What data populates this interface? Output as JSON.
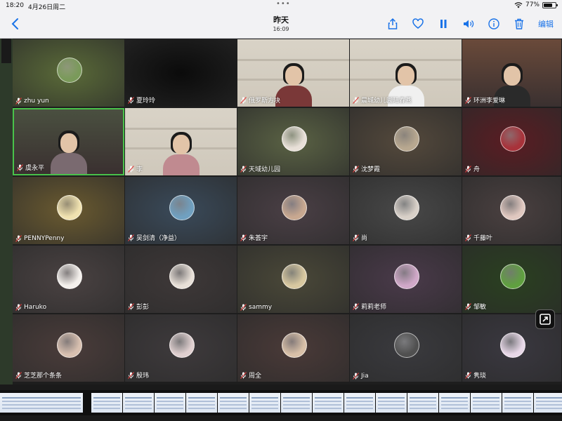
{
  "status_bar": {
    "time": "18:20",
    "date": "4月26日周二",
    "battery_pct": 77,
    "battery_text": "77%"
  },
  "nav": {
    "title": "昨天",
    "subtitle": "16:09",
    "edit_label": "编辑"
  },
  "participants": [
    {
      "name": "zhu yun",
      "bg": "#5a6a38",
      "avatar": "#7a9a5a"
    },
    {
      "name": "夏玲玲",
      "bg": "#0b0b0b"
    },
    {
      "name": "俄罗斯方块",
      "bg": "#cfc8bb",
      "video": true,
      "shirt": "#7a3838"
    },
    {
      "name": "晨城幼儿园陆春燕",
      "bg": "#cfc8bb",
      "video": true,
      "shirt": "#f0f0f0"
    },
    {
      "name": "环洲李爱琳",
      "bg": "#6a4a3a",
      "video": true,
      "shirt": "#2a2a2a"
    },
    {
      "name": "虞永平",
      "bg": "#4a5040",
      "video": true,
      "shirt": "#7a6a70",
      "active": true
    },
    {
      "name": "李",
      "bg": "#cfc8bb",
      "video": true,
      "shirt": "#c08a90"
    },
    {
      "name": "天域幼儿园",
      "bg": "#5a6244",
      "avatar": "#e8e0d8"
    },
    {
      "name": "沈梦霞",
      "bg": "#54493c",
      "avatar": "#b8a890"
    },
    {
      "name": "舟",
      "bg": "#5a1c22",
      "avatar": "#a8323a"
    },
    {
      "name": "PENNYPenny",
      "bg": "#6a5a30",
      "avatar": "#f0e2b0"
    },
    {
      "name": "吴剑清（净益）",
      "bg": "#3a4a5a",
      "avatar": "#70a0c0"
    },
    {
      "name": "朱荟宇",
      "bg": "#4a3f45",
      "avatar": "#c8a890"
    },
    {
      "name": "尚",
      "bg": "#484848",
      "avatar": "#d8d0c8"
    },
    {
      "name": "千藤叶",
      "bg": "#4a4040",
      "avatar": "#e0c8c0"
    },
    {
      "name": "Haruko",
      "bg": "#4a4242",
      "avatar": "#f4f0ec"
    },
    {
      "name": "彭彭",
      "bg": "#3e3838",
      "avatar": "#e8e0d8"
    },
    {
      "name": "sammy",
      "bg": "#4a4838",
      "avatar": "#d8c8a0"
    },
    {
      "name": "莉莉老师",
      "bg": "#4a3a4a",
      "avatar": "#d0a8c8"
    },
    {
      "name": "邹敏",
      "bg": "#2a4020",
      "avatar": "#60a040"
    },
    {
      "name": "芝芝那个条条",
      "bg": "#4a3c3a",
      "avatar": "#d8c0b0"
    },
    {
      "name": "殷玮",
      "bg": "#3e3a3c",
      "avatar": "#e0d0d0"
    },
    {
      "name": "周全",
      "bg": "#4a3a38",
      "avatar": "#d8c0a8"
    },
    {
      "name": "Jia",
      "bg": "#3a3a3e",
      "avatar": "#505050"
    },
    {
      "name": "隽琰",
      "bg": "#3a3840",
      "avatar": "#e8d8e8"
    }
  ]
}
